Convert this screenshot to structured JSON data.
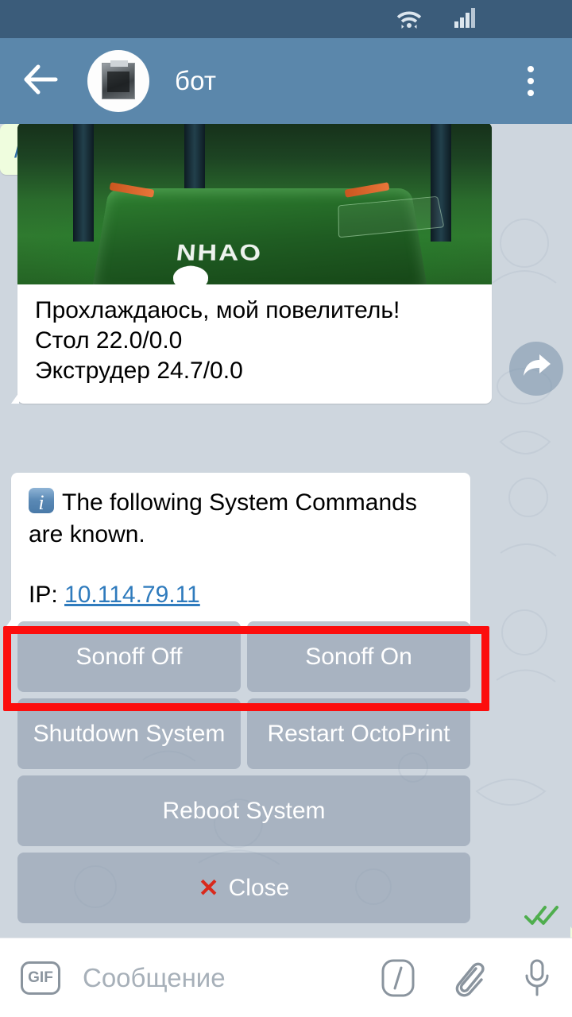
{
  "status_bar": {
    "wifi_icon": "wifi-icon",
    "signal_icon": "cellular-signal-icon"
  },
  "header": {
    "back_icon": "back-arrow-icon",
    "avatar_icon": "bot-avatar",
    "title": "бот",
    "menu_icon": "overflow-menu-icon"
  },
  "messages": {
    "photo_message": {
      "photo_alt": "3d-printer-bed-photo",
      "text": "Прохлаждаюсь, мой повелитель!\nСтол 22.0/0.0\nЭкструдер 24.7/0.0"
    },
    "outgoing": {
      "text": "/sys",
      "status_icon": "double-check-read-icon"
    },
    "forward_icon": "forward-arrow-icon",
    "info_message": {
      "emoji": "information-emoji",
      "line1": "The following System Commands",
      "line2": "are known.",
      "ip_label": "IP:",
      "ip_value": "10.114.79.11"
    }
  },
  "keyboard": {
    "rows": [
      [
        {
          "label": "Sonoff Off"
        },
        {
          "label": "Sonoff On"
        }
      ],
      [
        {
          "label": "Shutdown System"
        },
        {
          "label": "Restart OctoPrint"
        }
      ],
      [
        {
          "label": "Reboot System"
        }
      ],
      [
        {
          "label": "Close",
          "icon": "red-cross-mark",
          "icon_glyph": "✕"
        }
      ]
    ]
  },
  "annotation": {
    "color": "#fc0d0d",
    "target": "sonoff-buttons-row"
  },
  "input_bar": {
    "gif_label": "GIF",
    "placeholder": "Сообщение",
    "command_icon": "slash-command-icon",
    "attach_icon": "paperclip-icon",
    "mic_icon": "microphone-icon"
  }
}
